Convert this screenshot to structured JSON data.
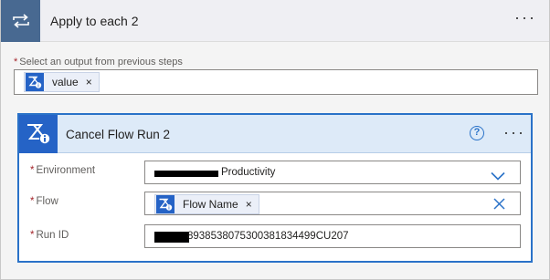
{
  "loop": {
    "title": "Apply to each 2",
    "more_label": "···",
    "icon": "loop-icon"
  },
  "previous_steps": {
    "label": "Select an output from previous steps",
    "required_marker": "*",
    "token": {
      "label": "value",
      "remove": "×",
      "icon": "flow-icon"
    }
  },
  "action": {
    "title": "Cancel Flow Run 2",
    "help_label": "?",
    "more_label": "···",
    "icon": "flow-icon",
    "fields": [
      {
        "label": "Environment",
        "required_marker": "*",
        "value": "Productivity",
        "control": "chevron-down-icon"
      },
      {
        "label": "Flow",
        "required_marker": "*",
        "token": {
          "label": "Flow Name",
          "remove": "×",
          "icon": "flow-icon"
        },
        "control": "clear-icon"
      },
      {
        "label": "Run ID",
        "required_marker": "*",
        "value": "8938538075300381834499CU207"
      }
    ]
  },
  "colors": {
    "loop_tile": "#486991",
    "action_tile": "#2563c6",
    "action_border": "#2a72c8",
    "action_header": "#ddeaf8",
    "required": "#a4262c"
  }
}
